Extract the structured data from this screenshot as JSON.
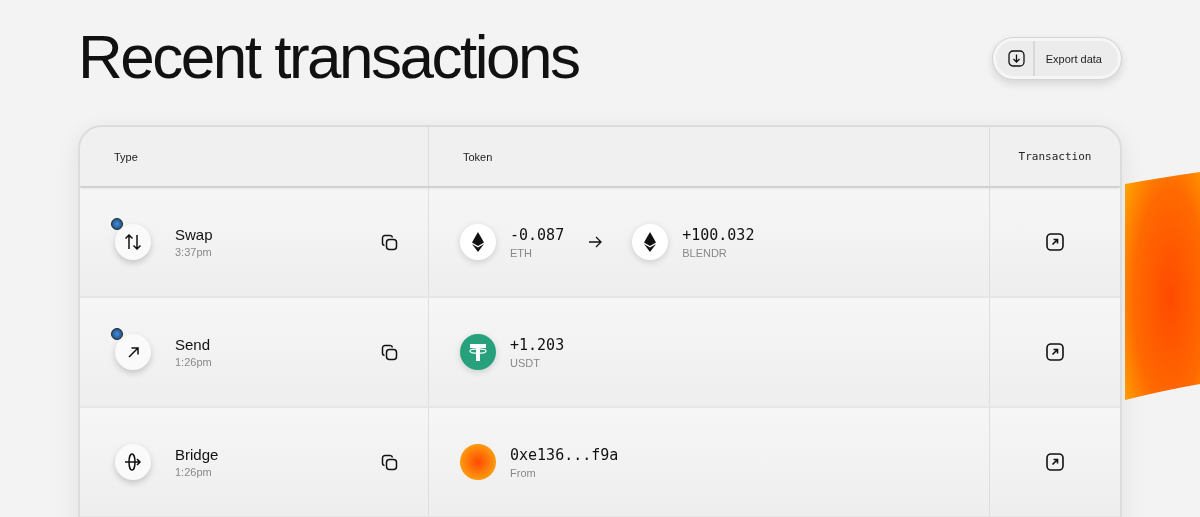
{
  "title": "Recent transactions",
  "export_button": {
    "label": "Export data"
  },
  "table": {
    "columns": [
      "Type",
      "Token",
      "Transaction"
    ],
    "rows": [
      {
        "kind": "swap",
        "network_badge": true,
        "name": "Swap",
        "time": "3:37pm",
        "tokens": [
          {
            "kind": "eth",
            "amount": "-0.087",
            "symbol": "ETH"
          },
          {
            "kind": "eth",
            "amount": "+100.032",
            "symbol": "BLENDR"
          }
        ]
      },
      {
        "kind": "send",
        "network_badge": true,
        "name": "Send",
        "time": "1:26pm",
        "tokens": [
          {
            "kind": "usdt",
            "amount": "+1.203",
            "symbol": "USDT"
          }
        ]
      },
      {
        "kind": "bridge",
        "network_badge": false,
        "name": "Bridge",
        "time": "1:26pm",
        "tokens": [
          {
            "kind": "avatar",
            "amount": "0xe136...f9a",
            "symbol": "From"
          }
        ]
      }
    ]
  }
}
